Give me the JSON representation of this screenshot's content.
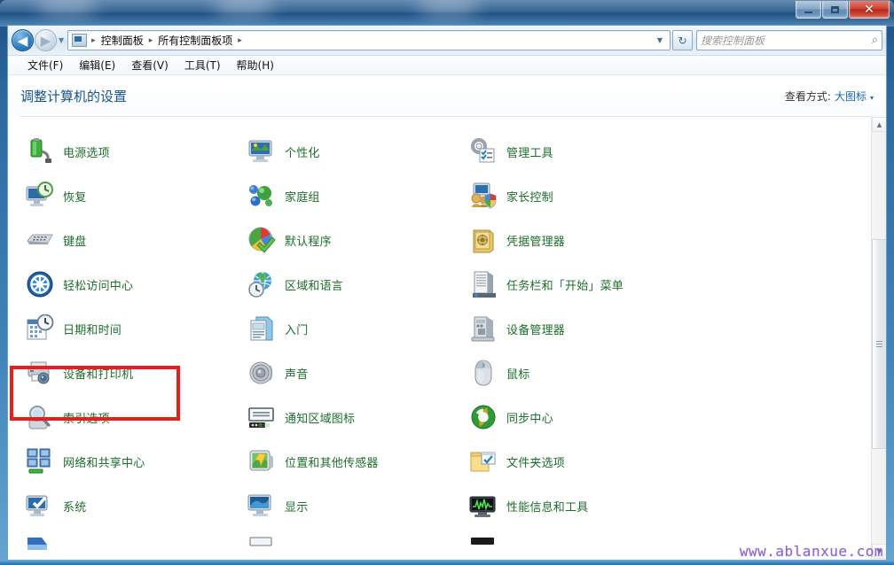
{
  "window": {
    "title": "",
    "controls": {
      "minimize": "–",
      "maximize": "□",
      "close": "✕"
    }
  },
  "nav": {
    "back_glyph": "◀",
    "forward_glyph": "▶",
    "recent_glyph": "▼",
    "breadcrumb": [
      "控制面板",
      "所有控制面板项"
    ],
    "separator": "▸",
    "dropdown_glyph": "▼",
    "refresh_glyph": "↻"
  },
  "search": {
    "placeholder": "搜索控制面板",
    "value": "",
    "icon_glyph": "⌕"
  },
  "menubar": {
    "items": [
      "文件(F)",
      "编辑(E)",
      "查看(V)",
      "工具(T)",
      "帮助(H)"
    ]
  },
  "header": {
    "title": "调整计算机的设置",
    "view_by_label": "查看方式:",
    "view_by_value": "大图标",
    "view_by_caret": "▾"
  },
  "grid": {
    "items": [
      {
        "label": "",
        "icon": "clipped-row-icon-1",
        "clipped": true
      },
      {
        "label": "",
        "icon": "clipped-row-icon-2",
        "clipped": true
      },
      {
        "label": "",
        "icon": "clipped-row-icon-3",
        "clipped": true
      },
      {
        "label": "电源选项",
        "icon": "battery-plug-icon"
      },
      {
        "label": "个性化",
        "icon": "monitor-paint-icon"
      },
      {
        "label": "管理工具",
        "icon": "gear-checklist-icon"
      },
      {
        "label": "恢复",
        "icon": "monitor-clock-icon"
      },
      {
        "label": "家庭组",
        "icon": "homegroup-nodes-icon"
      },
      {
        "label": "家长控制",
        "icon": "parental-shield-icon"
      },
      {
        "label": "键盘",
        "icon": "keyboard-icon"
      },
      {
        "label": "默认程序",
        "icon": "default-programs-icon"
      },
      {
        "label": "凭据管理器",
        "icon": "vault-icon"
      },
      {
        "label": "轻松访问中心",
        "icon": "ease-of-access-icon",
        "highlighted": true
      },
      {
        "label": "区域和语言",
        "icon": "globe-clock-icon"
      },
      {
        "label": "任务栏和「开始」菜单",
        "icon": "taskbar-start-icon"
      },
      {
        "label": "日期和时间",
        "icon": "calendar-clock-icon"
      },
      {
        "label": "入门",
        "icon": "getting-started-icon"
      },
      {
        "label": "设备管理器",
        "icon": "device-manager-icon"
      },
      {
        "label": "设备和打印机",
        "icon": "printer-camera-icon"
      },
      {
        "label": "声音",
        "icon": "speaker-icon"
      },
      {
        "label": "鼠标",
        "icon": "mouse-icon"
      },
      {
        "label": "索引选项",
        "icon": "magnifier-index-icon"
      },
      {
        "label": "通知区域图标",
        "icon": "notification-area-icon"
      },
      {
        "label": "同步中心",
        "icon": "sync-center-icon"
      },
      {
        "label": "网络和共享中心",
        "icon": "network-sharing-icon"
      },
      {
        "label": "位置和其他传感器",
        "icon": "gps-sensor-icon"
      },
      {
        "label": "文件夹选项",
        "icon": "folder-options-icon"
      },
      {
        "label": "系统",
        "icon": "system-icon"
      },
      {
        "label": "显示",
        "icon": "display-icon"
      },
      {
        "label": "性能信息和工具",
        "icon": "performance-icon"
      },
      {
        "label": "",
        "icon": "clipped-bottom-icon-1",
        "clipped": true
      },
      {
        "label": "",
        "icon": "clipped-bottom-icon-2",
        "clipped": true
      },
      {
        "label": "",
        "icon": "clipped-bottom-icon-3",
        "clipped": true
      }
    ]
  },
  "scrollbar": {
    "up_glyph": "▲",
    "down_glyph": "▼"
  },
  "annotation": {
    "highlight_target": "轻松访问中心",
    "highlight_color": "#ed1c1c"
  },
  "watermark": {
    "text": "www.ablanxue.com",
    "color": "#8a64d6"
  }
}
